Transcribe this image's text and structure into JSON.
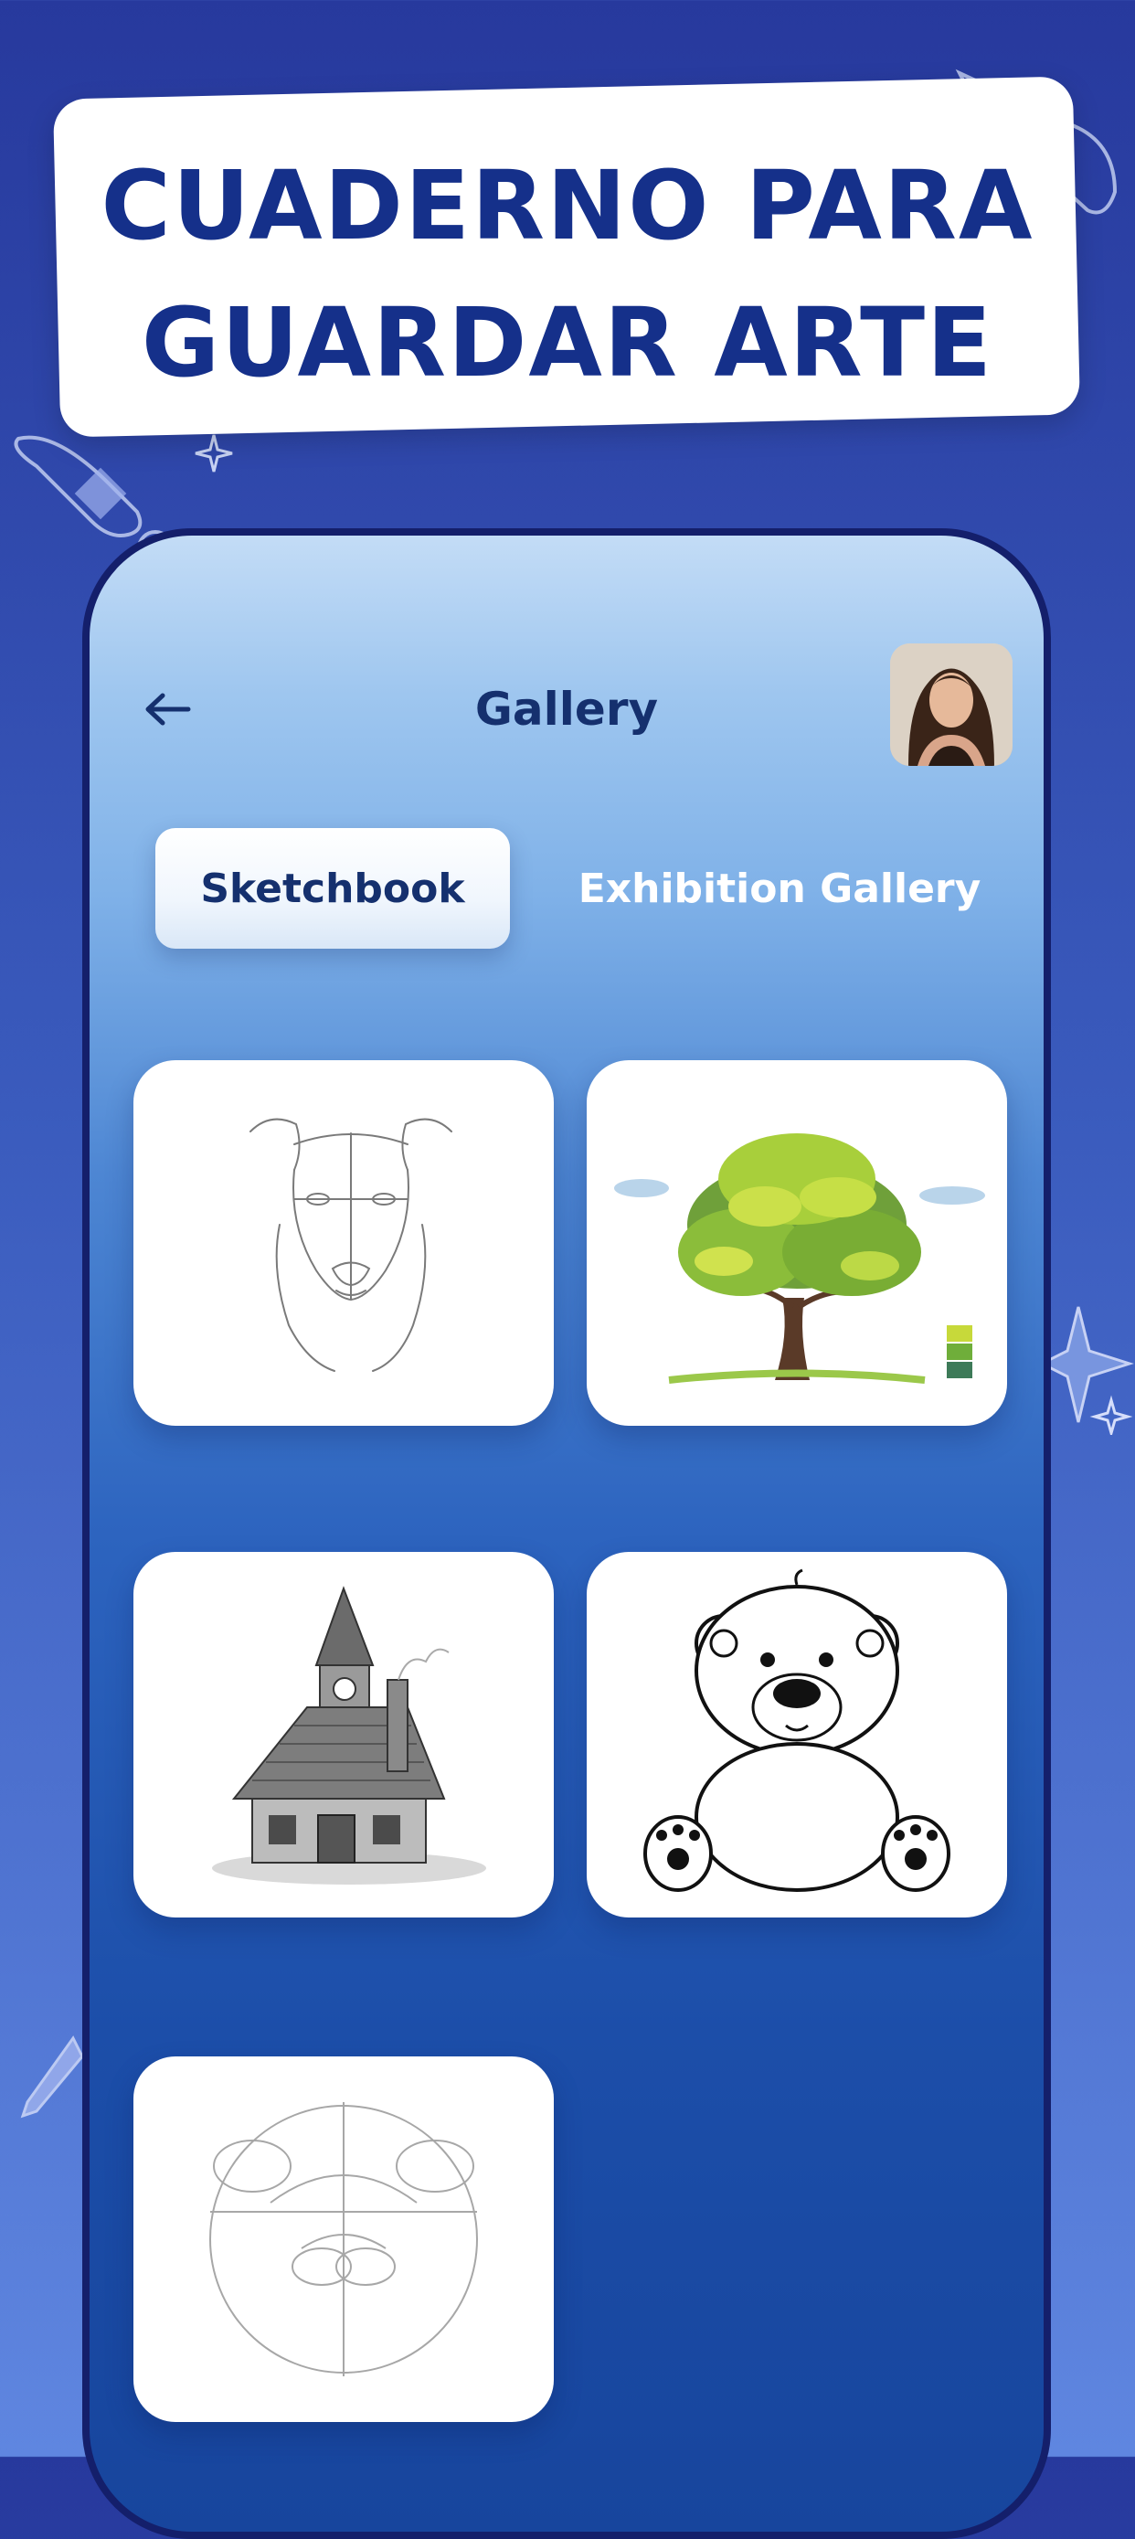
{
  "headline": {
    "line1": "CUADERNO PARA",
    "line2": "GUARDAR ARTE"
  },
  "header": {
    "title": "Gallery",
    "back_icon": "arrow-left-icon",
    "avatar": "user-avatar-photo"
  },
  "tabs": [
    {
      "label": "Sketchbook",
      "active": true
    },
    {
      "label": "Exhibition Gallery",
      "active": false
    }
  ],
  "gallery": {
    "items": [
      {
        "subject": "dog-sketch"
      },
      {
        "subject": "tree-painting"
      },
      {
        "subject": "house-sketch"
      },
      {
        "subject": "teddy-bear-drawing"
      },
      {
        "subject": "bear-face-guidelines"
      }
    ]
  },
  "colors": {
    "background_top": "#27399d",
    "background_bottom": "#5f86e0",
    "headline_text": "#15308a",
    "title_text": "#15306e",
    "phone_frame": "#141f6b"
  }
}
